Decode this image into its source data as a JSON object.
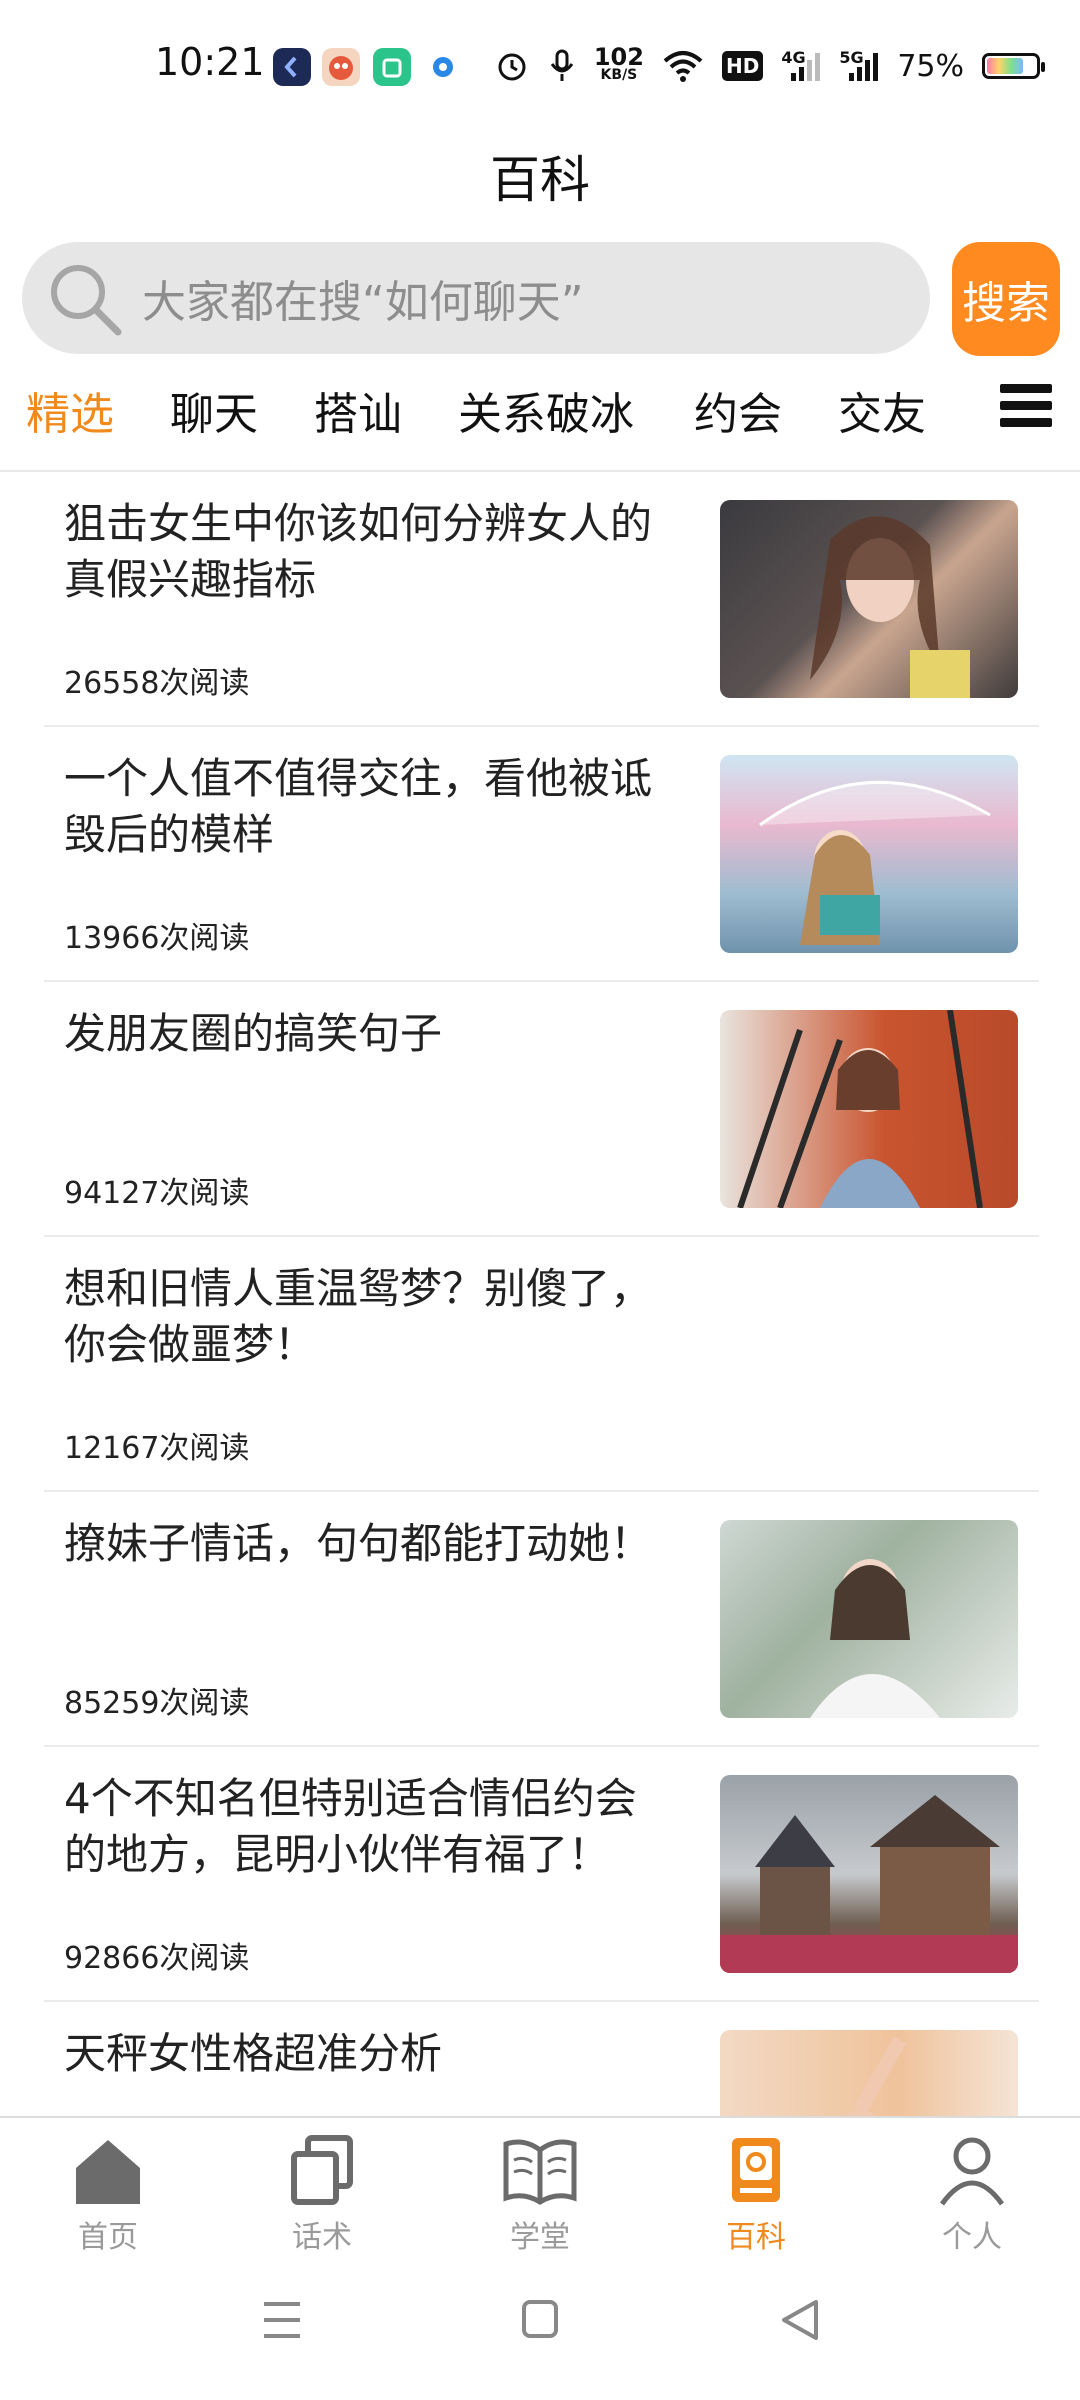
{
  "status_bar": {
    "time": "10:21",
    "net_speed": "102\nKB/S",
    "net_speed_top": "102",
    "net_speed_bottom": "KB/S",
    "hd": "HD",
    "signal1": "4G",
    "signal2": "5G",
    "battery": "75%",
    "icons": [
      "app-icon-blue",
      "app-icon-mascot",
      "app-icon-green",
      "app-icon-dot",
      "alarm-icon",
      "mic-icon",
      "wifi-icon",
      "hd-icon",
      "signal-4g-icon",
      "signal-5g-icon",
      "battery-icon"
    ]
  },
  "header": {
    "title": "百科"
  },
  "search": {
    "placeholder": "大家都在搜“如何聊天”",
    "button_label": "搜索"
  },
  "tabs": [
    {
      "label": "精选",
      "active": true
    },
    {
      "label": "聊天"
    },
    {
      "label": "搭讪"
    },
    {
      "label": "关系破冰"
    },
    {
      "label": "约会"
    },
    {
      "label": "交友"
    }
  ],
  "articles": [
    {
      "title": "狙击女生中你该如何分辨女人的真假兴趣指标",
      "reads": "26558次阅读",
      "has_image": true,
      "image": "woman-long-hair-photo"
    },
    {
      "title": "一个人值不值得交往，看他被诋毁后的模样",
      "reads": "13966次阅读",
      "has_image": true,
      "image": "anime-girl-umbrella-illustration"
    },
    {
      "title": "发朋友圈的搞笑句子",
      "reads": "94127次阅读",
      "has_image": true,
      "image": "girl-on-stairs-photo"
    },
    {
      "title": "想和旧情人重温鸳梦？别傻了，你会做噩梦！",
      "reads": "12167次阅读",
      "has_image": false
    },
    {
      "title": "撩妹子情话，句句都能打动她！",
      "reads": "85259次阅读",
      "has_image": true,
      "image": "girl-looking-up-photo"
    },
    {
      "title": "4个不知名但特别适合情侣约会的地方，昆明小伙伴有福了！",
      "reads": "92866次阅读",
      "has_image": true,
      "image": "european-town-photo"
    },
    {
      "title": "天秤女性格超准分析",
      "reads": "",
      "has_image": true,
      "image": "girl-stretching-photo"
    }
  ],
  "bottom_nav": [
    {
      "label": "首页",
      "icon": "home-icon"
    },
    {
      "label": "话术",
      "icon": "copy-cards-icon"
    },
    {
      "label": "学堂",
      "icon": "book-icon"
    },
    {
      "label": "百科",
      "icon": "encyclopedia-icon",
      "active": true
    },
    {
      "label": "个人",
      "icon": "person-icon"
    }
  ],
  "colors": {
    "accent": "#f08a1c",
    "search_button": "#ff8a1f",
    "inactive": "#9a9a9a"
  }
}
